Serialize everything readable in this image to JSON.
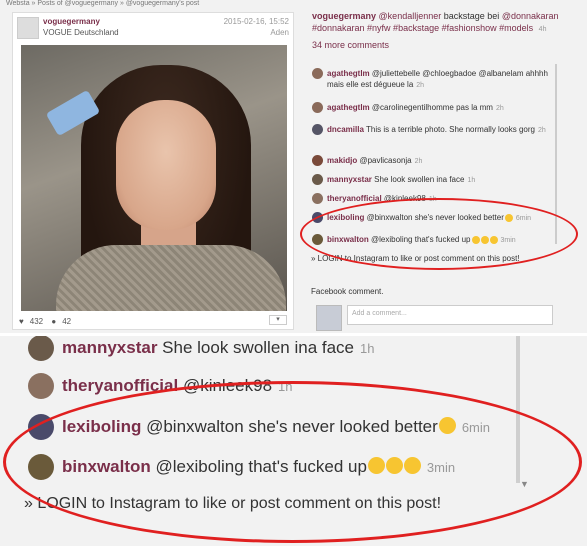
{
  "breadcrumb": "Websta » Posts of @voguegermany » @voguegermany's post",
  "post": {
    "username": "voguegermany",
    "subtitle": "VOGUE Deutschland",
    "date": "2015-02-16, 15:52",
    "location": "Aden",
    "likes": "432",
    "comments_count": "42",
    "caption_user": "voguegermany",
    "caption_mention": "@kendalljenner",
    "caption_text": "backstage bei",
    "caption_tags": "@donnakaran #donnakaran #nyfw #backstage #fashionshow #models",
    "caption_time": "4h",
    "more_comments": "34 more comments"
  },
  "comments": [
    {
      "user": "agathegtlm",
      "text": "@juliettebelle @chloegbadoe @albanelam ahhhh mais elle est dégueue la",
      "time": "2h",
      "color": "#8a6a5a"
    },
    {
      "user": "agathegtlm",
      "text": "@carolinegentilhomme pas la mm",
      "time": "2h",
      "color": "#8a6a5a"
    },
    {
      "user": "dncamilla",
      "text": "This is a terrible photo. She normally looks gorg",
      "time": "2h",
      "color": "#556"
    },
    {
      "user": "makidjo",
      "text": "@pavlicasonja",
      "time": "2h",
      "color": "#7a4a3a"
    },
    {
      "user": "mannyxstar",
      "text": "She look swollen ina face",
      "time": "1h",
      "color": "#6a5a4a"
    },
    {
      "user": "theryanofficial",
      "text": "@kinleek98",
      "time": "1h",
      "color": "#8a7060"
    },
    {
      "user": "lexiboling",
      "text": "@binxwalton she's never looked better",
      "time": "6min",
      "color": "#4a4a6a"
    },
    {
      "user": "binxwalton",
      "text": "@lexiboling that's fucked up",
      "time": "3min",
      "color": "#6a5a3a"
    }
  ],
  "login_text": "» LOGIN to Instagram to like or post comment on this post!",
  "facebook_label": "Facebook comment.",
  "facebook_placeholder": "Add a comment...",
  "zoom": {
    "comments": [
      {
        "user": "mannyxstar",
        "text": "She look swollen ina face",
        "time": "1h",
        "color": "#6a5a4a"
      },
      {
        "user": "theryanofficial",
        "text": "@kinleek98",
        "time": "1h",
        "color": "#8a7060"
      },
      {
        "user": "lexiboling",
        "text": "@binxwalton she's never looked better",
        "time": "6min",
        "color": "#4a4a6a"
      },
      {
        "user": "binxwalton",
        "text": "@lexiboling that's fucked up",
        "time": "3min",
        "color": "#6a5a3a"
      }
    ],
    "login_text": "» LOGIN to Instagram to like or post comment on this post!"
  },
  "colors": {
    "username": "#7a2f4a",
    "highlight": "#e02020"
  },
  "icons": {
    "like": "heart-icon",
    "comment": "speech-bubble-icon",
    "menu": "chevron-down-icon"
  }
}
